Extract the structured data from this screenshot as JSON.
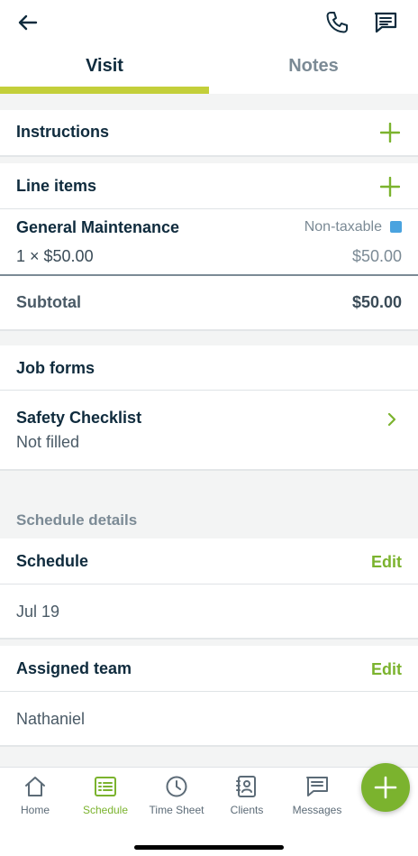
{
  "tabs": {
    "visit": "Visit",
    "notes": "Notes"
  },
  "instructions": {
    "title": "Instructions"
  },
  "line_items": {
    "title": "Line items",
    "items": [
      {
        "name": "General Maintenance",
        "tax": "Non-taxable",
        "qty_price": "1 × $50.00",
        "total": "$50.00"
      }
    ],
    "subtotal_label": "Subtotal",
    "subtotal_value": "$50.00"
  },
  "job_forms": {
    "title": "Job forms",
    "form_name": "Safety Checklist",
    "form_status": "Not filled"
  },
  "schedule_details": {
    "label": "Schedule details",
    "schedule_title": "Schedule",
    "schedule_edit": "Edit",
    "schedule_date": "Jul 19",
    "team_title": "Assigned team",
    "team_edit": "Edit",
    "team_member": "Nathaniel"
  },
  "nav": {
    "home": "Home",
    "schedule": "Schedule",
    "timesheet": "Time Sheet",
    "clients": "Clients",
    "messages": "Messages"
  },
  "colors": {
    "accent": "#7bb32e",
    "tab_underline": "#c3cf3a",
    "tax_badge": "#4aa3df"
  }
}
